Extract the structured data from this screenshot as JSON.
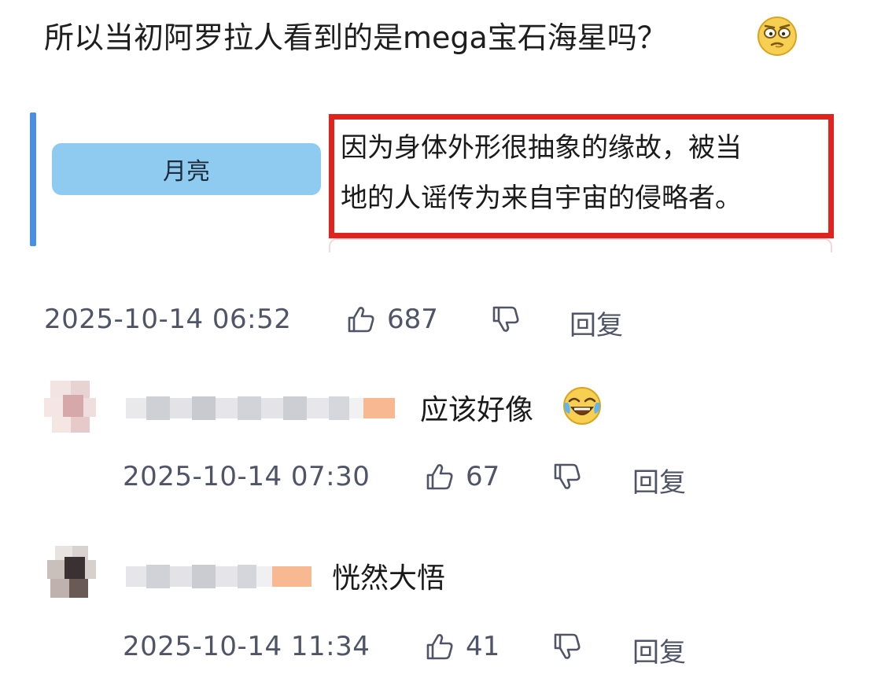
{
  "comment": {
    "text": "所以当初阿罗拉人看到的是mega宝石海星吗？",
    "emoji_icon": "thinking-face-icon",
    "quote": {
      "tag": "月亮",
      "line1": "因为身体外形很抽象的缘故，被当",
      "line2": "地的人谣传为来自宇宙的侵略者。"
    },
    "time": "2025-10-14 06:52",
    "likes": "687",
    "reply_label": "回复"
  },
  "replies": [
    {
      "text": "应该好像",
      "emoji_icon": "laughing-crying-face-icon",
      "time": "2025-10-14 07:30",
      "likes": "67",
      "reply_label": "回复"
    },
    {
      "text": "恍然大悟",
      "time": "2025-10-14 11:34",
      "likes": "41",
      "reply_label": "回复"
    }
  ],
  "colors": {
    "highlight_border": "#e0231f",
    "quote_bar": "#4a90e2",
    "tag_bg": "#8fcbf1",
    "meta_text": "#4f5467"
  }
}
